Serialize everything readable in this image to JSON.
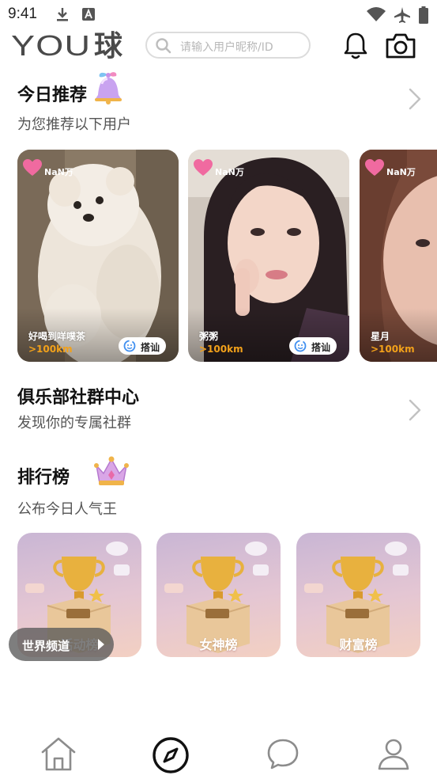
{
  "status_bar": {
    "time": "9:41",
    "icons": [
      "download-icon",
      "app-a-icon",
      "wifi-icon",
      "airplane-icon",
      "battery-icon"
    ]
  },
  "header": {
    "logo_latin": "YOU",
    "logo_cjk": "球",
    "search_placeholder": "请输入用户昵称/ID",
    "icons": [
      "bell-icon",
      "camera-icon"
    ]
  },
  "recommend": {
    "title": "今日推荐",
    "subtitle": "为您推荐以下用户",
    "cards": [
      {
        "likes": "NaN万",
        "name": "好喝到咩噗茶",
        "distance": ">100km",
        "greet_label": "搭讪"
      },
      {
        "likes": "NaN万",
        "name": "粥粥",
        "distance": ">100km",
        "greet_label": "搭讪"
      },
      {
        "likes": "NaN万",
        "name": "星月",
        "distance": ">100km"
      }
    ]
  },
  "club": {
    "title": "俱乐部社群中心",
    "subtitle": "发现你的专属社群"
  },
  "ranking": {
    "title": "排行榜",
    "subtitle": "公布今日人气王",
    "cards": [
      {
        "label": "活动榜"
      },
      {
        "label": "女神榜"
      },
      {
        "label": "财富榜"
      }
    ],
    "world_channel": "世界频道"
  },
  "tabbar": {
    "items": [
      "home-icon",
      "compass-icon",
      "chat-icon",
      "profile-icon"
    ],
    "active": 1
  },
  "colors": {
    "distance": "#f2a11a",
    "heart": "#f06aa0",
    "text_primary": "#111111",
    "text_secondary": "#555555"
  }
}
